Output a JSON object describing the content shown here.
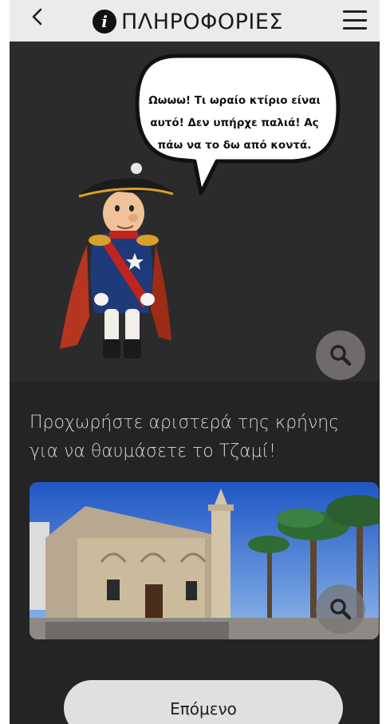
{
  "header": {
    "back_icon": "chevron-left-icon",
    "info_icon": "info-circle-icon",
    "title": "ΠΛΗΡΟΦΟΡΙΕΣ",
    "menu_icon": "hamburger-menu-icon"
  },
  "hero": {
    "speech": "Ωωωω! Τι ωραίο κτίριο είναι αυτό! Δεν υπήρχε παλιά! Ας πάω να το δω από κοντά.",
    "zoom_icon": "magnifier-icon"
  },
  "instruction": "Προχωρήστε αριστερά της κρήνης για να θαυμάσετε το Τζαμί!",
  "photo": {
    "zoom_icon": "magnifier-icon"
  },
  "next_button": "Επόμενο",
  "colors": {
    "background": "#252424",
    "header": "#ebebeb",
    "button": "#e0e0e0",
    "text": "#d9d9d9"
  }
}
